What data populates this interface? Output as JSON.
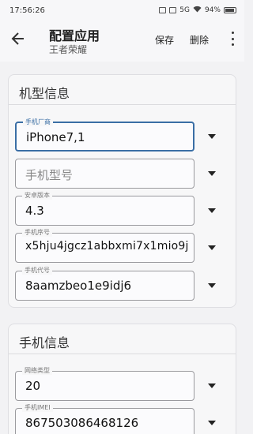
{
  "status_bar": {
    "time": "17:56:26",
    "network": "5G",
    "battery": "94%"
  },
  "app_bar": {
    "title": "配置应用",
    "subtitle": "王者荣耀",
    "save_label": "保存",
    "delete_label": "删除"
  },
  "device_card": {
    "title": "机型信息",
    "fields": [
      {
        "label": "手机厂商",
        "value": "iPhone7,1"
      },
      {
        "label": "",
        "placeholder": "手机型号",
        "value": ""
      },
      {
        "label": "安卓版本",
        "value": "4.3"
      },
      {
        "label": "手机序号",
        "value": "x5hju4jgcz1abbxmi7x1mio9j"
      },
      {
        "label": "手机代号",
        "value": "8aamzbeo1e9idj6"
      }
    ]
  },
  "phone_card": {
    "title": "手机信息",
    "fields": [
      {
        "label": "网络类型",
        "value": "20"
      },
      {
        "label": "手机IMEI",
        "value": "867503086468126"
      }
    ]
  }
}
